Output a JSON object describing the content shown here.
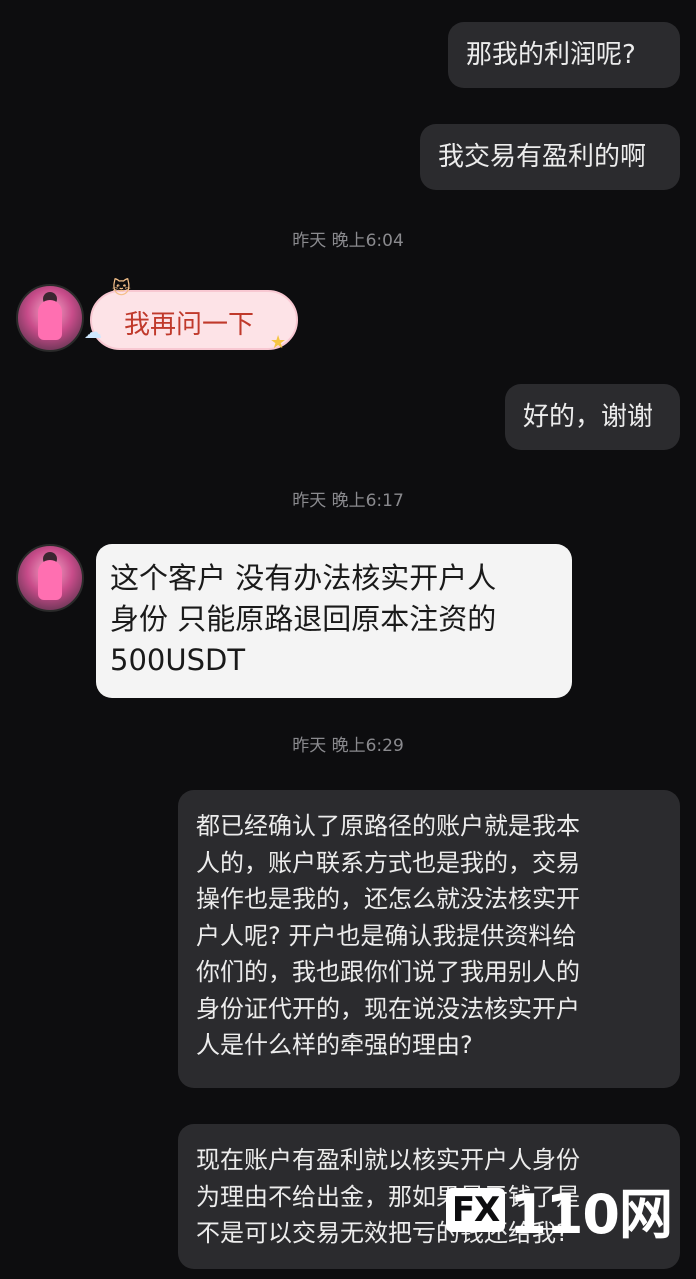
{
  "messages": {
    "out1": "那我的利润呢?",
    "out2": "我交易有盈利的啊",
    "ts1": "昨天 晚上6:04",
    "in1": "我再问一下",
    "out3": "好的，谢谢",
    "ts2": "昨天 晚上6:17",
    "in2_lines": [
      "这个客户 没有办法核实开户人",
      "身份 只能原路退回原本注资的",
      "500USDT"
    ],
    "ts3": "昨天 晚上6:29",
    "out4_lines": [
      "都已经确认了原路径的账户就是我本",
      "人的，账户联系方式也是我的，交易",
      "操作也是我的，还怎么就没法核实开",
      "户人呢? 开户也是确认我提供资料给",
      "你们的，我也跟你们说了我用别人的",
      "身份证代开的，现在说没法核实开户",
      "人是什么样的牵强的理由?"
    ],
    "out5_lines": [
      "现在账户有盈利就以核实开户人身份",
      "为理由不给出金，那如果是亏钱了是",
      "不是可以交易无效把亏的钱还给我?"
    ]
  },
  "watermark": {
    "fx": "FX",
    "text": "110网"
  },
  "colors": {
    "background": "#0d0d0f",
    "bubble_out": "#2b2b2e",
    "bubble_in": "#f4f4f4"
  }
}
